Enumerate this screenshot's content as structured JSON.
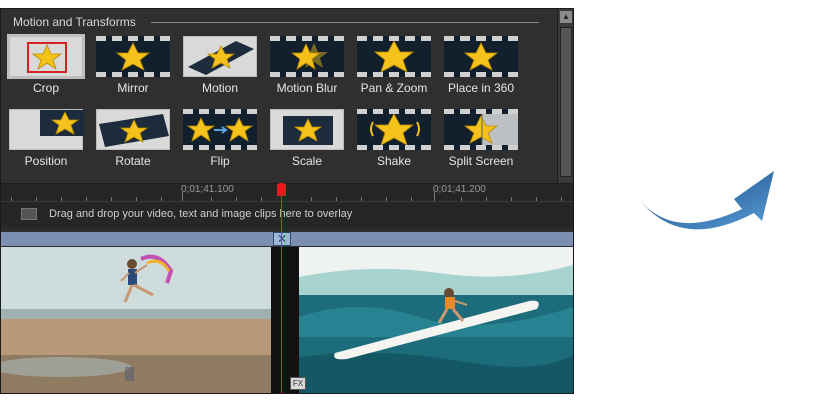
{
  "panel": {
    "section_title": "Motion and Transforms",
    "effects": [
      {
        "label": "Crop"
      },
      {
        "label": "Mirror"
      },
      {
        "label": "Motion"
      },
      {
        "label": "Motion Blur"
      },
      {
        "label": "Pan & Zoom"
      },
      {
        "label": "Place in 360"
      },
      {
        "label": "Position"
      },
      {
        "label": "Rotate"
      },
      {
        "label": "Flip"
      },
      {
        "label": "Scale"
      },
      {
        "label": "Shake"
      },
      {
        "label": "Split Screen"
      }
    ]
  },
  "timeline": {
    "ruler_labels": [
      "0;01;41.100",
      "0;01;41.200"
    ],
    "overlay_hint": "Drag and drop your video, text and image clips here to overlay",
    "fx_badge": "FX"
  },
  "colors": {
    "star": "#f4c21b",
    "playhead": "#e31b1b",
    "arrow": "#2b66a8"
  },
  "icons": {
    "transition": "transition-icon",
    "arrow": "curved-arrow-icon"
  }
}
